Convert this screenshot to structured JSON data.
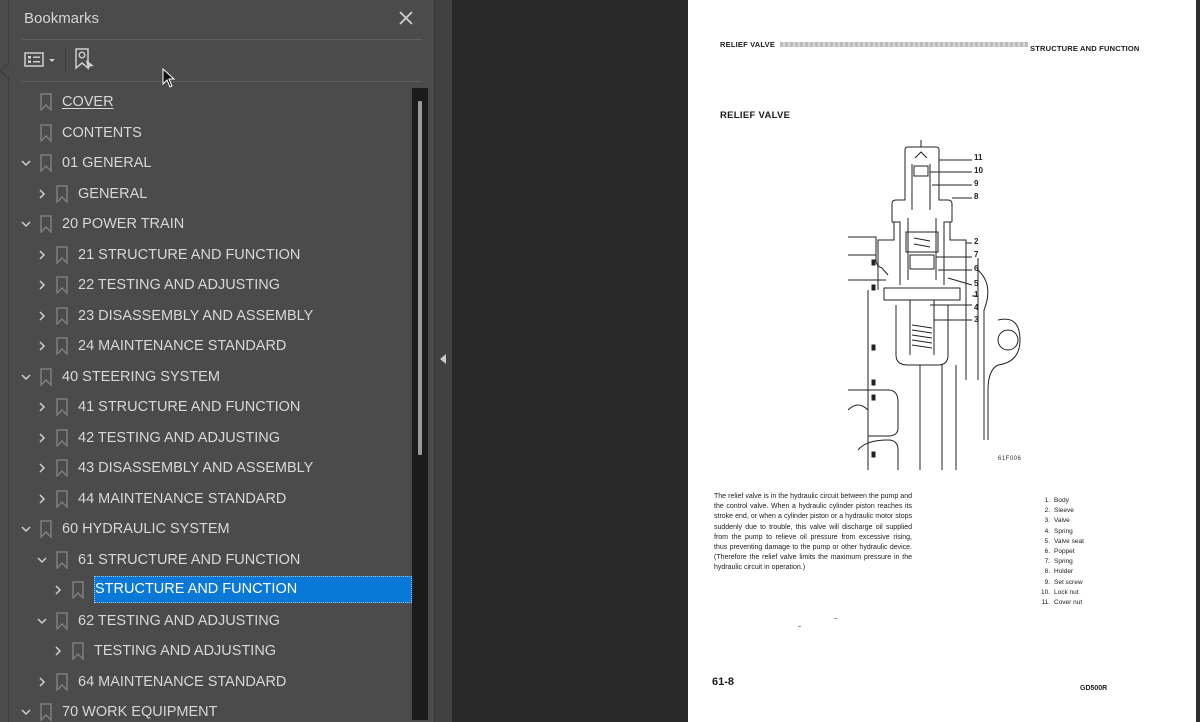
{
  "bookmarks_panel": {
    "title": "Bookmarks",
    "close_icon": "close-icon",
    "toolbar": {
      "options_icon": "list-options-icon",
      "dropdown_icon": "chevron-down-icon",
      "find_bookmark_icon": "find-current-bookmark-icon"
    },
    "items": [
      {
        "label": "COVER",
        "level": 0,
        "expander": "none",
        "underlined": true
      },
      {
        "label": "CONTENTS",
        "level": 0,
        "expander": "none"
      },
      {
        "label": "01 GENERAL",
        "level": 0,
        "expander": "expanded"
      },
      {
        "label": "GENERAL",
        "level": 1,
        "expander": "collapsed"
      },
      {
        "label": "20 POWER TRAIN",
        "level": 0,
        "expander": "expanded"
      },
      {
        "label": "21 STRUCTURE AND FUNCTION",
        "level": 1,
        "expander": "collapsed"
      },
      {
        "label": "22 TESTING AND ADJUSTING",
        "level": 1,
        "expander": "collapsed"
      },
      {
        "label": "23 DISASSEMBLY AND ASSEMBLY",
        "level": 1,
        "expander": "collapsed"
      },
      {
        "label": "24 MAINTENANCE STANDARD",
        "level": 1,
        "expander": "collapsed"
      },
      {
        "label": "40 STEERING SYSTEM",
        "level": 0,
        "expander": "expanded"
      },
      {
        "label": "41 STRUCTURE AND FUNCTION",
        "level": 1,
        "expander": "collapsed"
      },
      {
        "label": "42 TESTING AND ADJUSTING",
        "level": 1,
        "expander": "collapsed"
      },
      {
        "label": "43 DISASSEMBLY AND ASSEMBLY",
        "level": 1,
        "expander": "collapsed"
      },
      {
        "label": "44 MAINTENANCE STANDARD",
        "level": 1,
        "expander": "collapsed"
      },
      {
        "label": "60 HYDRAULIC SYSTEM",
        "level": 0,
        "expander": "expanded"
      },
      {
        "label": "61 STRUCTURE AND FUNCTION",
        "level": 1,
        "expander": "expanded"
      },
      {
        "label": "STRUCTURE AND FUNCTION",
        "level": 2,
        "expander": "collapsed",
        "selected": true
      },
      {
        "label": "62 TESTING AND ADJUSTING",
        "level": 1,
        "expander": "expanded"
      },
      {
        "label": "TESTING AND ADJUSTING",
        "level": 2,
        "expander": "collapsed"
      },
      {
        "label": "64 MAINTENANCE STANDARD",
        "level": 1,
        "expander": "collapsed"
      },
      {
        "label": "70 WORK EQUIPMENT",
        "level": 0,
        "expander": "expanded"
      }
    ],
    "selection_color": "#0a78d7"
  },
  "divider": {
    "collapse_icon": "collapse-left-arrow-icon"
  },
  "document": {
    "header_left": "RELIEF VALVE",
    "header_right": "STRUCTURE AND FUNCTION",
    "section_title": "RELIEF VALVE",
    "figure_callouts": [
      "11",
      "10",
      "9",
      "8",
      "2",
      "7",
      "6",
      "5",
      "1",
      "4",
      "3"
    ],
    "figure_id": "61F006",
    "description": "The relief valve is in the hydraulic circuit between the pump and the control valve. When a hydraulic cylinder piston reaches its stroke end, or when a cylinder piston or a hydraulic motor stops suddenly due to trouble, this valve will discharge oil supplied from the pump to relieve oil pressure from excessive rising, thus preventing damage to the pump or other hydraulic device. (Therefore the relief valve limits the maximum pressure in the hydraulic circuit in operation.)",
    "parts_list": [
      {
        "num": "1.",
        "name": "Body"
      },
      {
        "num": "2.",
        "name": "Sleeve"
      },
      {
        "num": "3.",
        "name": "Valve"
      },
      {
        "num": "4.",
        "name": "Spring"
      },
      {
        "num": "5.",
        "name": "Valve seat"
      },
      {
        "num": "6.",
        "name": "Poppet"
      },
      {
        "num": "7.",
        "name": "Spring"
      },
      {
        "num": "8.",
        "name": "Holder"
      },
      {
        "num": "9.",
        "name": "Set screw"
      },
      {
        "num": "10.",
        "name": "Lock nut"
      },
      {
        "num": "11.",
        "name": "Cover nut"
      }
    ],
    "page_number": "61-8",
    "model": "GD500R"
  }
}
